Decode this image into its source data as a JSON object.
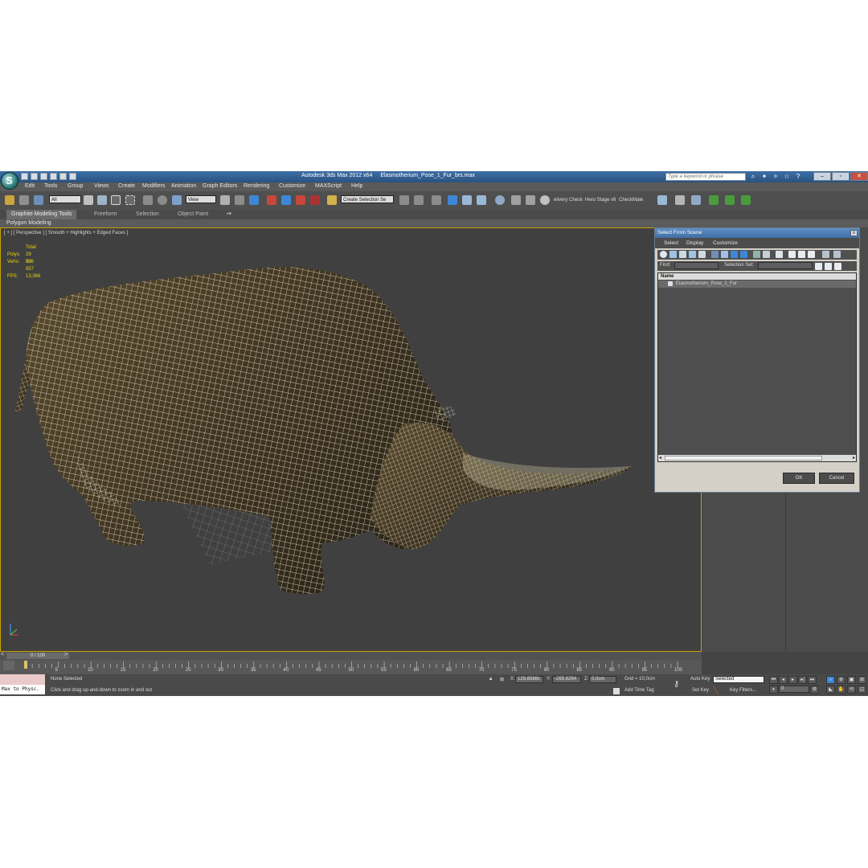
{
  "window": {
    "app_title": "Autodesk 3ds Max  2012 x64",
    "file_name": "Elasmotherium_Pose_1_Fur_brs.max",
    "search_placeholder": "Type a keyword or phrase",
    "minimize_label": "–",
    "restore_label": "▫",
    "close_label": "✕"
  },
  "menu": [
    "Edit",
    "Tools",
    "Group",
    "Views",
    "Create",
    "Modifiers",
    "Animation",
    "Graph Editors",
    "Rendering",
    "Customize",
    "MAXScript",
    "Help"
  ],
  "toolbar": {
    "selection_filter": "All",
    "ref_coord": "View",
    "named_selection": "Create Selection Se",
    "plugin_1": "elivery Check",
    "plugin_2": "Hero Stage v6",
    "plugin_3": "CheckMate"
  },
  "ribbon": {
    "tabs": [
      "Graphite Modeling Tools",
      "Freeform",
      "Selection",
      "Object Paint"
    ],
    "sub_label": "Polygon Modeling"
  },
  "viewport": {
    "label": "[ + ] [ Perspective ] [ Smooth + Highlights + Edged Faces ]",
    "stats_header": "Total",
    "polys_label": "Polys:",
    "polys_value": "29 926",
    "verts_label": "Verts:",
    "verts_value": "30 857",
    "fps_label": "FPS:",
    "fps_value": "13,366"
  },
  "dialog": {
    "title": "Select From Scene",
    "close_label": "x",
    "menu": [
      "Select",
      "Display",
      "Customize"
    ],
    "find_label": "Find:",
    "selection_set_label": "Selection Set:",
    "column_name": "Name",
    "items": [
      "Elasmotherium_Pose_1_Fur"
    ],
    "ok_label": "OK",
    "cancel_label": "Cancel"
  },
  "timeline": {
    "frame_display": "0 / 100",
    "ticks": [
      "5",
      "10",
      "15",
      "20",
      "25",
      "30",
      "35",
      "40",
      "45",
      "50",
      "55",
      "60",
      "65",
      "70",
      "75",
      "80",
      "85",
      "90",
      "95",
      "100"
    ]
  },
  "status": {
    "maxscript_label": "Max to Physc.",
    "selection": "None Selected",
    "prompt": "Click and drag up-and-down to zoom in and out",
    "x_label": "X:",
    "x_value": "129,8588c",
    "y_label": "Y:",
    "y_value": "-265,6294",
    "z_label": "Z:",
    "z_value": "0,0cm",
    "grid": "Grid = 10,0cm",
    "add_time_tag": "Add Time Tag",
    "auto_key": "Auto Key",
    "key_mode": "Selected",
    "set_key": "Set Key",
    "key_filters": "Key Filters...",
    "current_frame": "0"
  },
  "colors": {
    "title_bar": "#2f5f95",
    "viewport_bg": "#404040",
    "active_border": "#c8a400",
    "stats_text": "#e8d600"
  }
}
